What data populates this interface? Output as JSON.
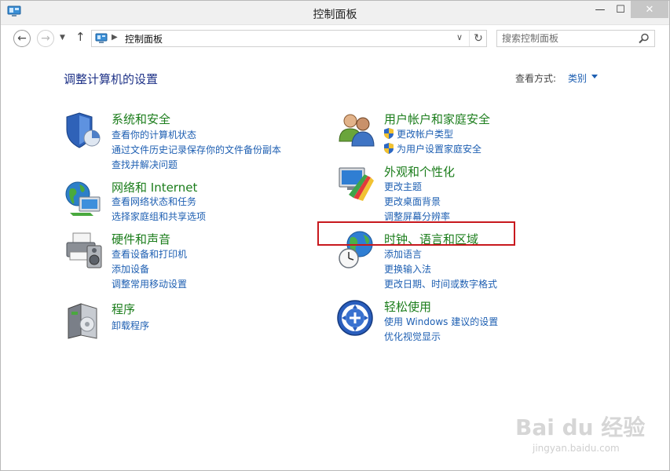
{
  "window": {
    "title": "控制面板",
    "controls": {
      "minimize": "—",
      "maximize": "☐",
      "close": "✕"
    }
  },
  "toolbar": {
    "back": "←",
    "forward": "→",
    "recent": "▼",
    "up": "↑",
    "address_separator": "▶",
    "address": "控制面板",
    "address_dropdown": "∨",
    "refresh": "↻",
    "search_placeholder": "搜索控制面板"
  },
  "main": {
    "heading": "调整计算机的设置",
    "view_by_label": "查看方式:",
    "view_by_value": "类别"
  },
  "categories": {
    "system": {
      "title": "系统和安全",
      "icon": "shield-security-icon",
      "links": [
        "查看你的计算机状态",
        "通过文件历史记录保存你的文件备份副本",
        "查找并解决问题"
      ]
    },
    "network": {
      "title": "网络和 Internet",
      "icon": "network-globe-icon",
      "links": [
        "查看网络状态和任务",
        "选择家庭组和共享选项"
      ]
    },
    "hardware": {
      "title": "硬件和声音",
      "icon": "printer-speaker-icon",
      "links": [
        "查看设备和打印机",
        "添加设备",
        "调整常用移动设置"
      ]
    },
    "programs": {
      "title": "程序",
      "icon": "programs-box-icon",
      "links": [
        "卸载程序"
      ]
    },
    "users": {
      "title": "用户帐户和家庭安全",
      "icon": "users-icon",
      "links": [
        "更改帐户类型",
        "为用户设置家庭安全"
      ]
    },
    "appearance": {
      "title": "外观和个性化",
      "icon": "monitor-palette-icon",
      "links": [
        "更改主题",
        "更改桌面背景",
        "调整屏幕分辨率"
      ]
    },
    "clock": {
      "title": "时钟、语言和区域",
      "icon": "globe-clock-icon",
      "links": [
        "添加语言",
        "更换输入法",
        "更改日期、时间或数字格式"
      ]
    },
    "ease": {
      "title": "轻松使用",
      "icon": "ease-of-access-icon",
      "links": [
        "使用 Windows 建议的设置",
        "优化视觉显示"
      ]
    }
  },
  "watermark": {
    "brand": "Bai du 经验",
    "url": "jingyan.baidu.com"
  },
  "colors": {
    "category_title": "#1b7d1b",
    "link": "#1e5fb2",
    "heading": "#1e3287",
    "highlight": "#c8191e"
  }
}
